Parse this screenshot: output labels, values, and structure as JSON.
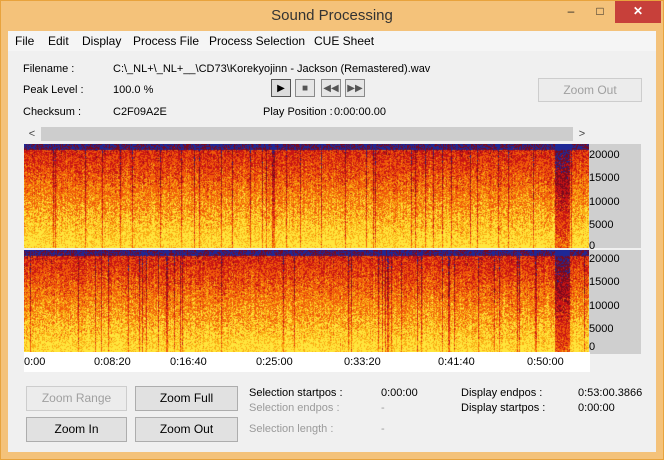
{
  "window": {
    "title": "Sound Processing",
    "min": "–",
    "max": "□",
    "close": "✕"
  },
  "menu": [
    {
      "label": "File"
    },
    {
      "label": "Edit"
    },
    {
      "label": "Display"
    },
    {
      "label": "Process File"
    },
    {
      "label": "Process Selection"
    },
    {
      "label": "CUE Sheet"
    }
  ],
  "info": {
    "filename_label": "Filename :",
    "filename_value": "C:\\_NL+\\_NL+__\\CD73\\Korekyojinn - Jackson (Remastered).wav",
    "peak_label": "Peak Level :",
    "peak_value": "100.0 %",
    "checksum_label": "Checksum :",
    "checksum_value": "C2F09A2E",
    "play_label": "Play Position :",
    "play_value": "0:00:00.00"
  },
  "transport": {
    "play": "▶",
    "stop": "■",
    "rewind": "◀◀",
    "forward": "▶▶"
  },
  "zoom_out_top": "Zoom Out",
  "scroll": {
    "left": "<",
    "right": ">"
  },
  "yaxis_ticks": [
    "20000",
    "15000",
    "10000",
    "5000",
    "0"
  ],
  "xaxis_ticks": [
    "0:00",
    "0:08:20",
    "0:16:40",
    "0:25:00",
    "0:33:20",
    "0:41:40",
    "0:50:00"
  ],
  "buttons": {
    "zoom_range": "Zoom Range",
    "zoom_full": "Zoom Full",
    "zoom_in": "Zoom In",
    "zoom_out": "Zoom Out"
  },
  "selection": {
    "startpos_label": "Selection startpos :",
    "startpos_value": "0:00:00",
    "endpos_label": "Selection endpos :",
    "endpos_value": "-",
    "length_label": "Selection length :",
    "length_value": "-"
  },
  "display": {
    "endpos_label": "Display endpos :",
    "endpos_value": "0:53:00.3866",
    "startpos_label": "Display startpos :",
    "startpos_value": "0:00:00"
  },
  "colors": {
    "spec_dark": "#6e0610",
    "spec_hot": "#ffe23a",
    "spec_gap": "#1a2c9a",
    "title_bar": "#f4c27a",
    "close": "#c7403a"
  }
}
